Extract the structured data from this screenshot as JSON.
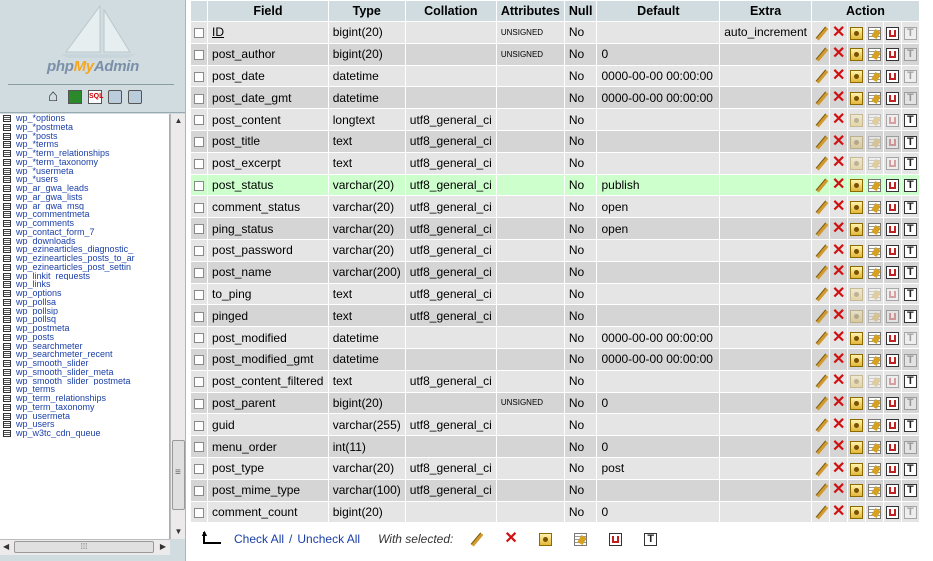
{
  "logo": {
    "php": "php",
    "my": "My",
    "admin": "Admin"
  },
  "nav_icons": [
    "home-icon",
    "sql-query-icon",
    "sql-window-icon",
    "docs-icon",
    "help-icon"
  ],
  "table_list": [
    "wp_*options",
    "wp_*postmeta",
    "wp_*posts",
    "wp_*terms",
    "wp_*term_relationships",
    "wp_*term_taxonomy",
    "wp_*usermeta",
    "wp_*users",
    "wp_ar_gwa_leads",
    "wp_ar_gwa_lists",
    "wp_ar_gwa_msg",
    "wp_commentmeta",
    "wp_comments",
    "wp_contact_form_7",
    "wp_downloads",
    "wp_ezinearticles_diagnostic_",
    "wp_ezinearticles_posts_to_ar",
    "wp_ezinearticles_post_settin",
    "wp_linkit_requests",
    "wp_links",
    "wp_options",
    "wp_pollsa",
    "wp_pollsip",
    "wp_pollsq",
    "wp_postmeta",
    "wp_posts",
    "wp_searchmeter",
    "wp_searchmeter_recent",
    "wp_smooth_slider",
    "wp_smooth_slider_meta",
    "wp_smooth_slider_postmeta",
    "wp_terms",
    "wp_term_relationships",
    "wp_term_taxonomy",
    "wp_usermeta",
    "wp_users",
    "wp_w3tc_cdn_queue"
  ],
  "headers": {
    "field": "Field",
    "type": "Type",
    "collation": "Collation",
    "attributes": "Attributes",
    "null": "Null",
    "default": "Default",
    "extra": "Extra",
    "action": "Action"
  },
  "rows": [
    {
      "field": "ID",
      "type": "bigint(20)",
      "collation": "",
      "attributes": "UNSIGNED",
      "null": "No",
      "default": "",
      "extra": "auto_increment",
      "pk_dim": false,
      "uniq_dim": false,
      "idx_dim": false,
      "ft_dim": true
    },
    {
      "field": "post_author",
      "type": "bigint(20)",
      "collation": "",
      "attributes": "UNSIGNED",
      "null": "No",
      "default": "0",
      "extra": "",
      "pk_dim": false,
      "uniq_dim": false,
      "idx_dim": false,
      "ft_dim": true
    },
    {
      "field": "post_date",
      "type": "datetime",
      "collation": "",
      "attributes": "",
      "null": "No",
      "default": "0000-00-00 00:00:00",
      "extra": "",
      "pk_dim": false,
      "uniq_dim": false,
      "idx_dim": false,
      "ft_dim": true
    },
    {
      "field": "post_date_gmt",
      "type": "datetime",
      "collation": "",
      "attributes": "",
      "null": "No",
      "default": "0000-00-00 00:00:00",
      "extra": "",
      "pk_dim": false,
      "uniq_dim": false,
      "idx_dim": false,
      "ft_dim": true
    },
    {
      "field": "post_content",
      "type": "longtext",
      "collation": "utf8_general_ci",
      "attributes": "",
      "null": "No",
      "default": "",
      "extra": "",
      "pk_dim": true,
      "uniq_dim": true,
      "idx_dim": true,
      "ft_dim": false
    },
    {
      "field": "post_title",
      "type": "text",
      "collation": "utf8_general_ci",
      "attributes": "",
      "null": "No",
      "default": "",
      "extra": "",
      "pk_dim": true,
      "uniq_dim": true,
      "idx_dim": true,
      "ft_dim": false
    },
    {
      "field": "post_excerpt",
      "type": "text",
      "collation": "utf8_general_ci",
      "attributes": "",
      "null": "No",
      "default": "",
      "extra": "",
      "pk_dim": true,
      "uniq_dim": true,
      "idx_dim": true,
      "ft_dim": false
    },
    {
      "field": "post_status",
      "type": "varchar(20)",
      "collation": "utf8_general_ci",
      "attributes": "",
      "null": "No",
      "default": "publish",
      "extra": "",
      "pk_dim": false,
      "uniq_dim": false,
      "idx_dim": false,
      "ft_dim": false
    },
    {
      "field": "comment_status",
      "type": "varchar(20)",
      "collation": "utf8_general_ci",
      "attributes": "",
      "null": "No",
      "default": "open",
      "extra": "",
      "pk_dim": false,
      "uniq_dim": false,
      "idx_dim": false,
      "ft_dim": false
    },
    {
      "field": "ping_status",
      "type": "varchar(20)",
      "collation": "utf8_general_ci",
      "attributes": "",
      "null": "No",
      "default": "open",
      "extra": "",
      "pk_dim": false,
      "uniq_dim": false,
      "idx_dim": false,
      "ft_dim": false
    },
    {
      "field": "post_password",
      "type": "varchar(20)",
      "collation": "utf8_general_ci",
      "attributes": "",
      "null": "No",
      "default": "",
      "extra": "",
      "pk_dim": false,
      "uniq_dim": false,
      "idx_dim": false,
      "ft_dim": false
    },
    {
      "field": "post_name",
      "type": "varchar(200)",
      "collation": "utf8_general_ci",
      "attributes": "",
      "null": "No",
      "default": "",
      "extra": "",
      "pk_dim": false,
      "uniq_dim": false,
      "idx_dim": false,
      "ft_dim": false
    },
    {
      "field": "to_ping",
      "type": "text",
      "collation": "utf8_general_ci",
      "attributes": "",
      "null": "No",
      "default": "",
      "extra": "",
      "pk_dim": true,
      "uniq_dim": true,
      "idx_dim": true,
      "ft_dim": false
    },
    {
      "field": "pinged",
      "type": "text",
      "collation": "utf8_general_ci",
      "attributes": "",
      "null": "No",
      "default": "",
      "extra": "",
      "pk_dim": true,
      "uniq_dim": true,
      "idx_dim": true,
      "ft_dim": false
    },
    {
      "field": "post_modified",
      "type": "datetime",
      "collation": "",
      "attributes": "",
      "null": "No",
      "default": "0000-00-00 00:00:00",
      "extra": "",
      "pk_dim": false,
      "uniq_dim": false,
      "idx_dim": false,
      "ft_dim": true
    },
    {
      "field": "post_modified_gmt",
      "type": "datetime",
      "collation": "",
      "attributes": "",
      "null": "No",
      "default": "0000-00-00 00:00:00",
      "extra": "",
      "pk_dim": false,
      "uniq_dim": false,
      "idx_dim": false,
      "ft_dim": true
    },
    {
      "field": "post_content_filtered",
      "type": "text",
      "collation": "utf8_general_ci",
      "attributes": "",
      "null": "No",
      "default": "",
      "extra": "",
      "pk_dim": true,
      "uniq_dim": true,
      "idx_dim": true,
      "ft_dim": false
    },
    {
      "field": "post_parent",
      "type": "bigint(20)",
      "collation": "",
      "attributes": "UNSIGNED",
      "null": "No",
      "default": "0",
      "extra": "",
      "pk_dim": false,
      "uniq_dim": false,
      "idx_dim": false,
      "ft_dim": true
    },
    {
      "field": "guid",
      "type": "varchar(255)",
      "collation": "utf8_general_ci",
      "attributes": "",
      "null": "No",
      "default": "",
      "extra": "",
      "pk_dim": false,
      "uniq_dim": false,
      "idx_dim": false,
      "ft_dim": false
    },
    {
      "field": "menu_order",
      "type": "int(11)",
      "collation": "",
      "attributes": "",
      "null": "No",
      "default": "0",
      "extra": "",
      "pk_dim": false,
      "uniq_dim": false,
      "idx_dim": false,
      "ft_dim": true
    },
    {
      "field": "post_type",
      "type": "varchar(20)",
      "collation": "utf8_general_ci",
      "attributes": "",
      "null": "No",
      "default": "post",
      "extra": "",
      "pk_dim": false,
      "uniq_dim": false,
      "idx_dim": false,
      "ft_dim": false
    },
    {
      "field": "post_mime_type",
      "type": "varchar(100)",
      "collation": "utf8_general_ci",
      "attributes": "",
      "null": "No",
      "default": "",
      "extra": "",
      "pk_dim": false,
      "uniq_dim": false,
      "idx_dim": false,
      "ft_dim": false
    },
    {
      "field": "comment_count",
      "type": "bigint(20)",
      "collation": "",
      "attributes": "",
      "null": "No",
      "default": "0",
      "extra": "",
      "pk_dim": false,
      "uniq_dim": false,
      "idx_dim": false,
      "ft_dim": true
    }
  ],
  "highlighted_row": "post_status",
  "footer": {
    "check_all": "Check All",
    "separator": "/",
    "uncheck_all": "Uncheck All",
    "with_selected": "With selected:"
  },
  "colors": {
    "header_bg": "#d0dce0",
    "row_even": "#e5e5e5",
    "row_odd": "#d5d5d5",
    "row_highlight": "#ccffcc",
    "link": "#1a3fa8",
    "drop_red": "#d01010"
  }
}
